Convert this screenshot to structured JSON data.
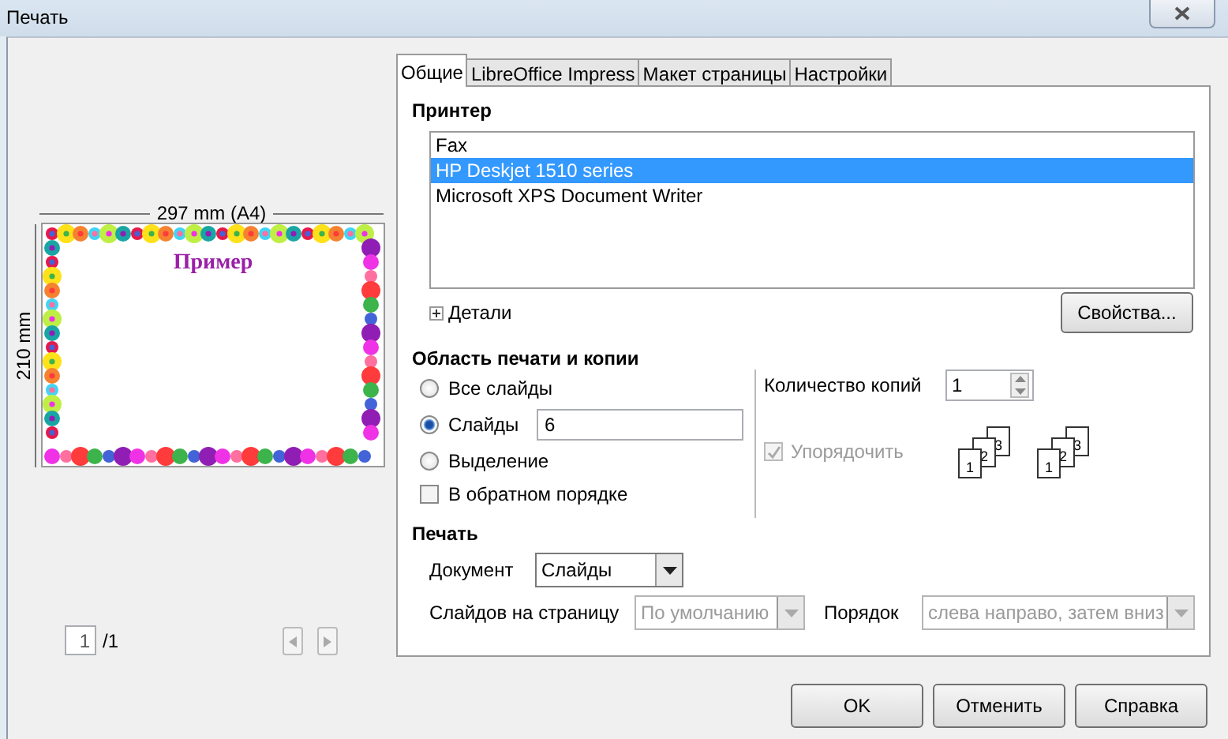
{
  "window": {
    "title": "Печать"
  },
  "preview": {
    "width_label": "297 mm (A4)",
    "height_label": "210 mm",
    "slide_title": "Пример",
    "page": "1",
    "page_count": "/1"
  },
  "tabs": [
    {
      "label": "Общие",
      "selected": true
    },
    {
      "label": "LibreOffice Impress",
      "selected": false
    },
    {
      "label": "Макет страницы",
      "selected": false
    },
    {
      "label": "Настройки",
      "selected": false
    }
  ],
  "printer": {
    "heading": "Принтер",
    "printers": [
      {
        "name": "Fax",
        "selected": false
      },
      {
        "name": "HP Deskjet 1510 series",
        "selected": true
      },
      {
        "name": "Microsoft XPS Document Writer",
        "selected": false
      }
    ],
    "details": "Детали",
    "details_expanded": false,
    "properties_button": "Свойства..."
  },
  "range": {
    "heading": "Область печати и копии",
    "options": [
      {
        "label": "Все слайды",
        "selected": false
      },
      {
        "label": "Слайды",
        "selected": true,
        "value": "6"
      },
      {
        "label": "Выделение",
        "selected": false
      }
    ],
    "reverse": {
      "label": "В обратном порядке",
      "checked": false
    },
    "copies_label": "Количество копий",
    "copies": "1",
    "collate": {
      "label": "Упорядочить",
      "checked": true,
      "disabled": true
    },
    "collate_icons": [
      [
        "1",
        "2",
        "3"
      ],
      [
        "1",
        "2",
        "3"
      ]
    ]
  },
  "print": {
    "heading": "Печать",
    "document_label": "Документ",
    "document": "Слайды",
    "per_page_label": "Слайдов на страницу",
    "per_page": "По умолчанию",
    "per_page_disabled": true,
    "order_label": "Порядок",
    "order": "слева направо, затем вниз",
    "order_disabled": true
  },
  "buttons": [
    "OK",
    "Отменить",
    "Справка"
  ]
}
